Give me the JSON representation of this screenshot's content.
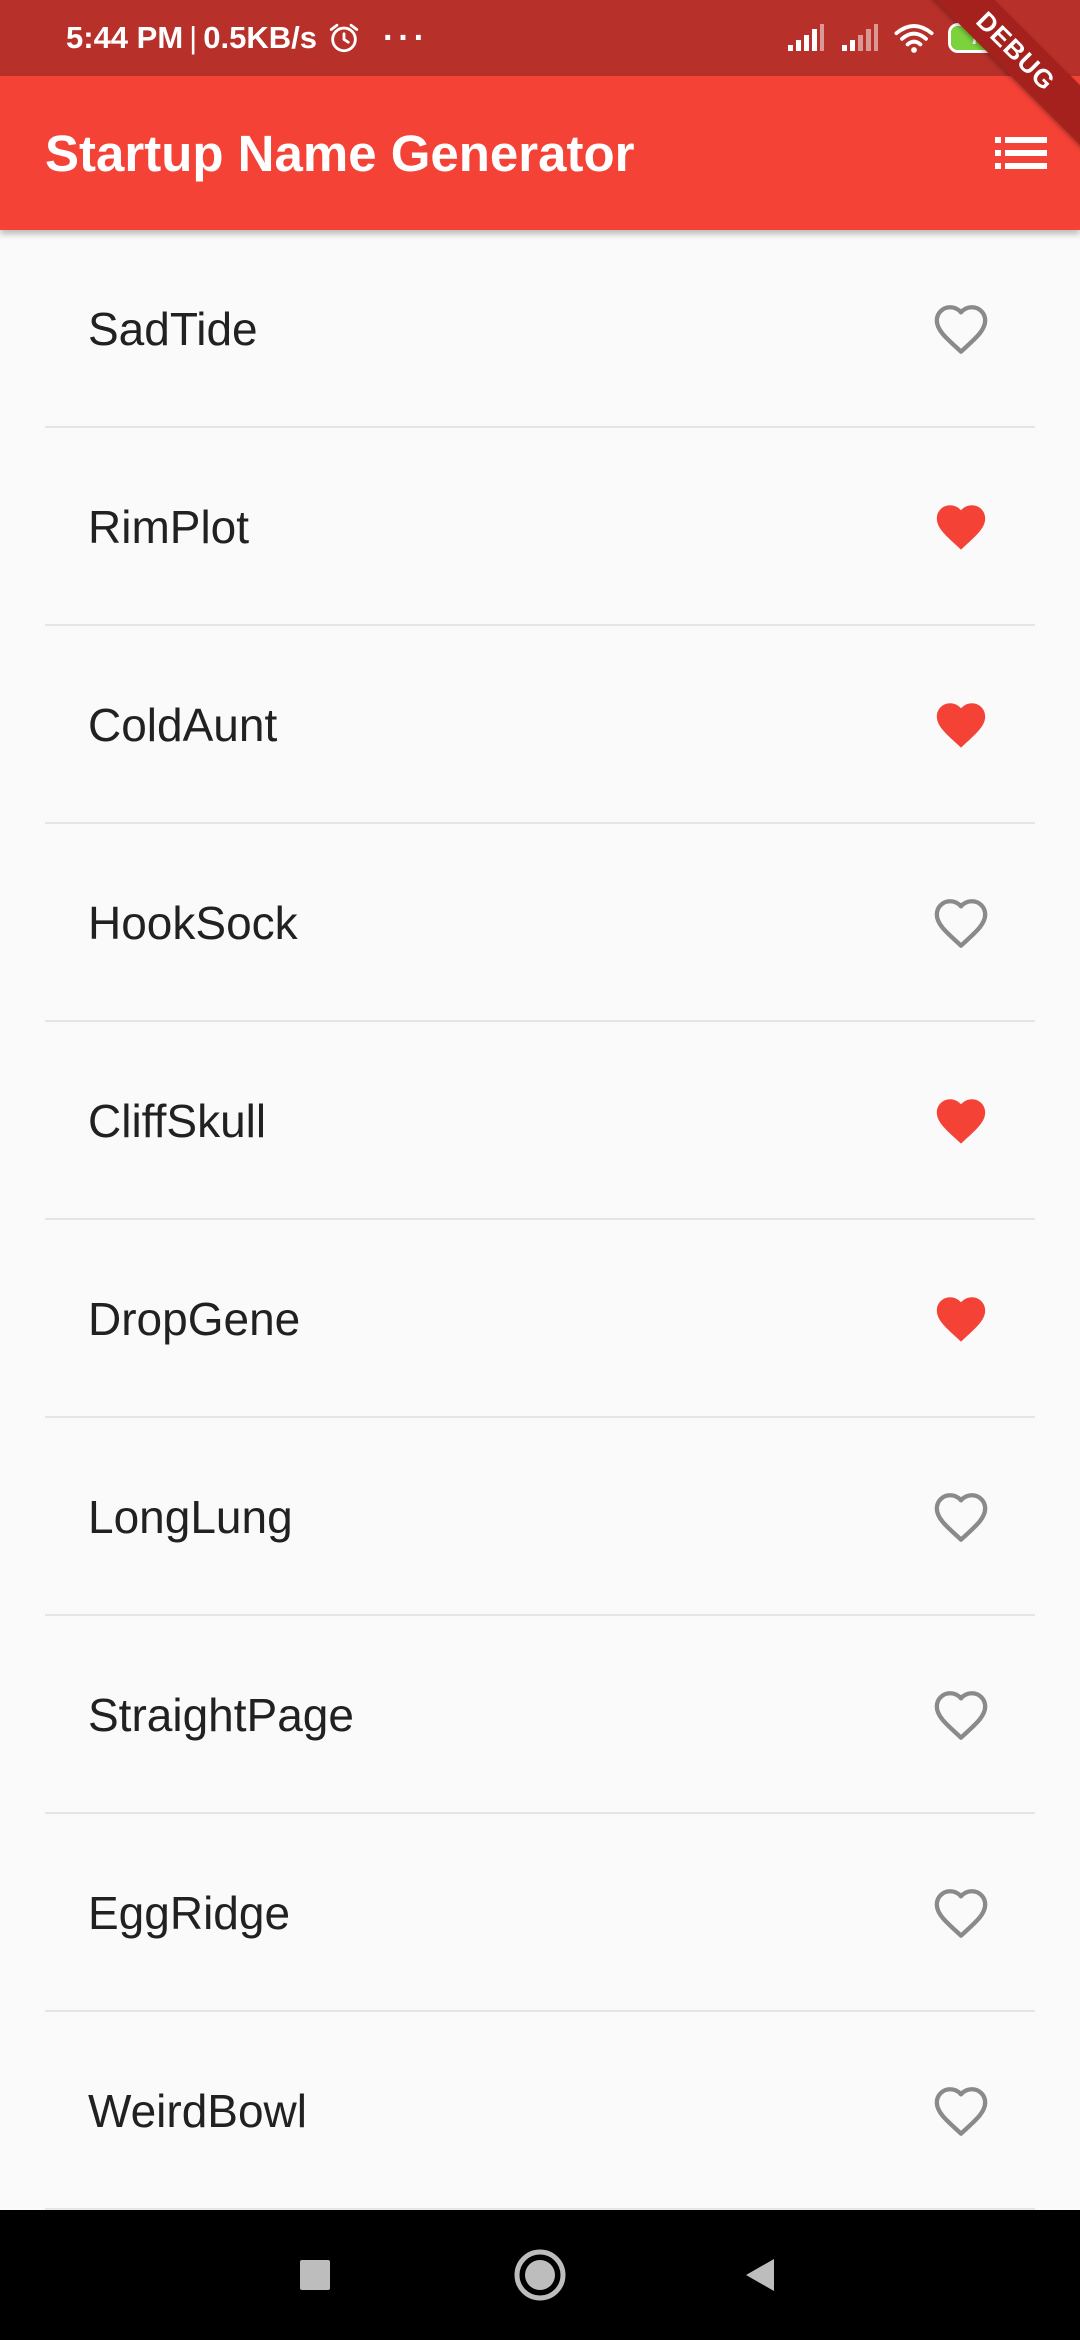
{
  "status_bar": {
    "time": "5:44 PM",
    "separator": "|",
    "network_speed": "0.5KB/s",
    "overflow_dots": "···",
    "battery_level": "75",
    "battery_fraction": 0.75,
    "icons": [
      "alarm-icon",
      "signal-icon",
      "signal-icon",
      "wifi-icon",
      "battery-icon"
    ]
  },
  "app_bar": {
    "title": "Startup Name Generator",
    "action_icon": "list-icon"
  },
  "debug_banner": {
    "label": "DEBUG"
  },
  "list": {
    "items": [
      {
        "name": "SadTide",
        "favorited": false
      },
      {
        "name": "RimPlot",
        "favorited": true
      },
      {
        "name": "ColdAunt",
        "favorited": true
      },
      {
        "name": "HookSock",
        "favorited": false
      },
      {
        "name": "CliffSkull",
        "favorited": true
      },
      {
        "name": "DropGene",
        "favorited": true
      },
      {
        "name": "LongLung",
        "favorited": false
      },
      {
        "name": "StraightPage",
        "favorited": false
      },
      {
        "name": "EggRidge",
        "favorited": false
      },
      {
        "name": "WeirdBowl",
        "favorited": false
      }
    ]
  },
  "nav_bar": {
    "buttons": [
      "recents-square-icon",
      "home-circle-icon",
      "back-triangle-icon"
    ]
  },
  "colors": {
    "status_bar": "#b7312a",
    "app_bar": "#f44336",
    "favorite": "#f44336",
    "unfavorite": "#8a8a8a",
    "background": "#fafafa",
    "divider": "#e5e5e5",
    "nav_bar": "#000000"
  }
}
